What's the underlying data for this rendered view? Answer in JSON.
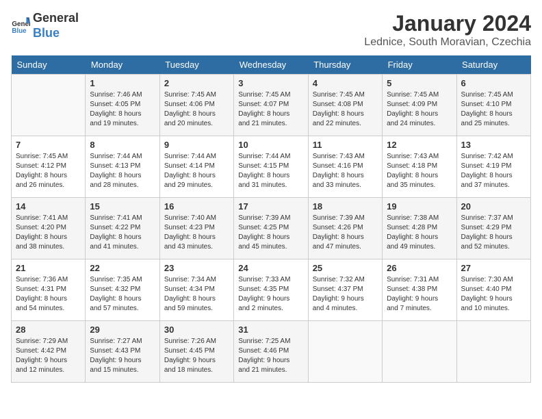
{
  "header": {
    "logo_general": "General",
    "logo_blue": "Blue",
    "month": "January 2024",
    "location": "Lednice, South Moravian, Czechia"
  },
  "days_of_week": [
    "Sunday",
    "Monday",
    "Tuesday",
    "Wednesday",
    "Thursday",
    "Friday",
    "Saturday"
  ],
  "weeks": [
    [
      {
        "day": "",
        "info": ""
      },
      {
        "day": "1",
        "info": "Sunrise: 7:46 AM\nSunset: 4:05 PM\nDaylight: 8 hours\nand 19 minutes."
      },
      {
        "day": "2",
        "info": "Sunrise: 7:45 AM\nSunset: 4:06 PM\nDaylight: 8 hours\nand 20 minutes."
      },
      {
        "day": "3",
        "info": "Sunrise: 7:45 AM\nSunset: 4:07 PM\nDaylight: 8 hours\nand 21 minutes."
      },
      {
        "day": "4",
        "info": "Sunrise: 7:45 AM\nSunset: 4:08 PM\nDaylight: 8 hours\nand 22 minutes."
      },
      {
        "day": "5",
        "info": "Sunrise: 7:45 AM\nSunset: 4:09 PM\nDaylight: 8 hours\nand 24 minutes."
      },
      {
        "day": "6",
        "info": "Sunrise: 7:45 AM\nSunset: 4:10 PM\nDaylight: 8 hours\nand 25 minutes."
      }
    ],
    [
      {
        "day": "7",
        "info": "Sunrise: 7:45 AM\nSunset: 4:12 PM\nDaylight: 8 hours\nand 26 minutes."
      },
      {
        "day": "8",
        "info": "Sunrise: 7:44 AM\nSunset: 4:13 PM\nDaylight: 8 hours\nand 28 minutes."
      },
      {
        "day": "9",
        "info": "Sunrise: 7:44 AM\nSunset: 4:14 PM\nDaylight: 8 hours\nand 29 minutes."
      },
      {
        "day": "10",
        "info": "Sunrise: 7:44 AM\nSunset: 4:15 PM\nDaylight: 8 hours\nand 31 minutes."
      },
      {
        "day": "11",
        "info": "Sunrise: 7:43 AM\nSunset: 4:16 PM\nDaylight: 8 hours\nand 33 minutes."
      },
      {
        "day": "12",
        "info": "Sunrise: 7:43 AM\nSunset: 4:18 PM\nDaylight: 8 hours\nand 35 minutes."
      },
      {
        "day": "13",
        "info": "Sunrise: 7:42 AM\nSunset: 4:19 PM\nDaylight: 8 hours\nand 37 minutes."
      }
    ],
    [
      {
        "day": "14",
        "info": "Sunrise: 7:41 AM\nSunset: 4:20 PM\nDaylight: 8 hours\nand 38 minutes."
      },
      {
        "day": "15",
        "info": "Sunrise: 7:41 AM\nSunset: 4:22 PM\nDaylight: 8 hours\nand 41 minutes."
      },
      {
        "day": "16",
        "info": "Sunrise: 7:40 AM\nSunset: 4:23 PM\nDaylight: 8 hours\nand 43 minutes."
      },
      {
        "day": "17",
        "info": "Sunrise: 7:39 AM\nSunset: 4:25 PM\nDaylight: 8 hours\nand 45 minutes."
      },
      {
        "day": "18",
        "info": "Sunrise: 7:39 AM\nSunset: 4:26 PM\nDaylight: 8 hours\nand 47 minutes."
      },
      {
        "day": "19",
        "info": "Sunrise: 7:38 AM\nSunset: 4:28 PM\nDaylight: 8 hours\nand 49 minutes."
      },
      {
        "day": "20",
        "info": "Sunrise: 7:37 AM\nSunset: 4:29 PM\nDaylight: 8 hours\nand 52 minutes."
      }
    ],
    [
      {
        "day": "21",
        "info": "Sunrise: 7:36 AM\nSunset: 4:31 PM\nDaylight: 8 hours\nand 54 minutes."
      },
      {
        "day": "22",
        "info": "Sunrise: 7:35 AM\nSunset: 4:32 PM\nDaylight: 8 hours\nand 57 minutes."
      },
      {
        "day": "23",
        "info": "Sunrise: 7:34 AM\nSunset: 4:34 PM\nDaylight: 8 hours\nand 59 minutes."
      },
      {
        "day": "24",
        "info": "Sunrise: 7:33 AM\nSunset: 4:35 PM\nDaylight: 9 hours\nand 2 minutes."
      },
      {
        "day": "25",
        "info": "Sunrise: 7:32 AM\nSunset: 4:37 PM\nDaylight: 9 hours\nand 4 minutes."
      },
      {
        "day": "26",
        "info": "Sunrise: 7:31 AM\nSunset: 4:38 PM\nDaylight: 9 hours\nand 7 minutes."
      },
      {
        "day": "27",
        "info": "Sunrise: 7:30 AM\nSunset: 4:40 PM\nDaylight: 9 hours\nand 10 minutes."
      }
    ],
    [
      {
        "day": "28",
        "info": "Sunrise: 7:29 AM\nSunset: 4:42 PM\nDaylight: 9 hours\nand 12 minutes."
      },
      {
        "day": "29",
        "info": "Sunrise: 7:27 AM\nSunset: 4:43 PM\nDaylight: 9 hours\nand 15 minutes."
      },
      {
        "day": "30",
        "info": "Sunrise: 7:26 AM\nSunset: 4:45 PM\nDaylight: 9 hours\nand 18 minutes."
      },
      {
        "day": "31",
        "info": "Sunrise: 7:25 AM\nSunset: 4:46 PM\nDaylight: 9 hours\nand 21 minutes."
      },
      {
        "day": "",
        "info": ""
      },
      {
        "day": "",
        "info": ""
      },
      {
        "day": "",
        "info": ""
      }
    ]
  ]
}
